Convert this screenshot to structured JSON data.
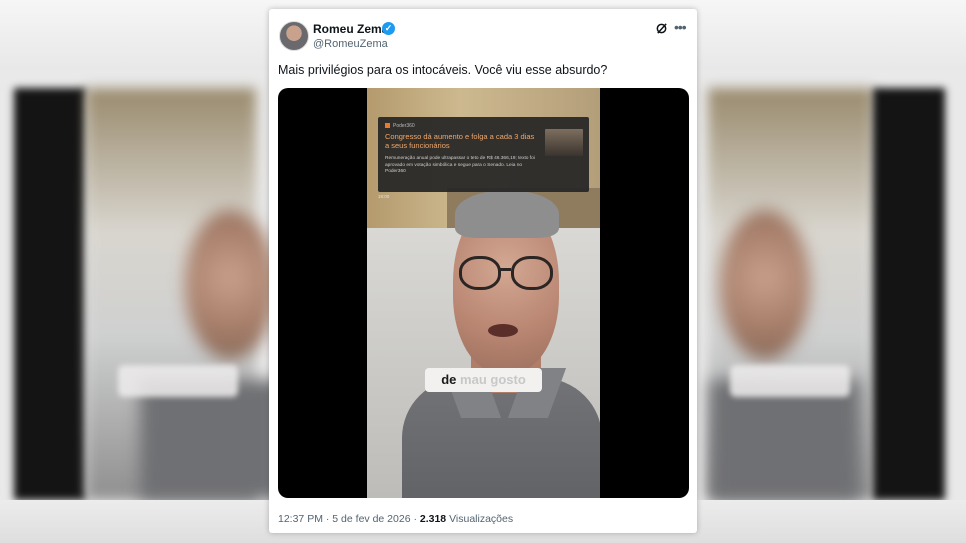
{
  "tweet": {
    "author_name": "Romeu Zema",
    "author_handle": "@RomeuZema",
    "text": "Mais privilégios para os intocáveis. Você viu esse absurdo?",
    "time": "12:37 PM",
    "separator": "·",
    "date": "5 de fev de 2026",
    "views_count": "2.318",
    "views_label": "Visualizações"
  },
  "video": {
    "news_source": "Poder360",
    "news_headline": "Congresso dá aumento e folga a cada 3 dias a seus funcionários",
    "news_body": "Remuneração anual pode ultrapassar o teto de R$ 46.366,19; texto foi aprovado em votação simbólica e segue para o Senado. Leia no Poder360",
    "news_time": "18:00",
    "caption_word1": "de",
    "caption_word2": "mau gosto"
  },
  "colors": {
    "verified_badge": "#1d9bf0",
    "text_primary": "#0f1419",
    "text_secondary": "#536471",
    "headline_orange": "#f0a76a"
  },
  "icons": {
    "verified": "verified-badge-icon",
    "grok": "grok-icon",
    "more": "more-options-icon"
  }
}
